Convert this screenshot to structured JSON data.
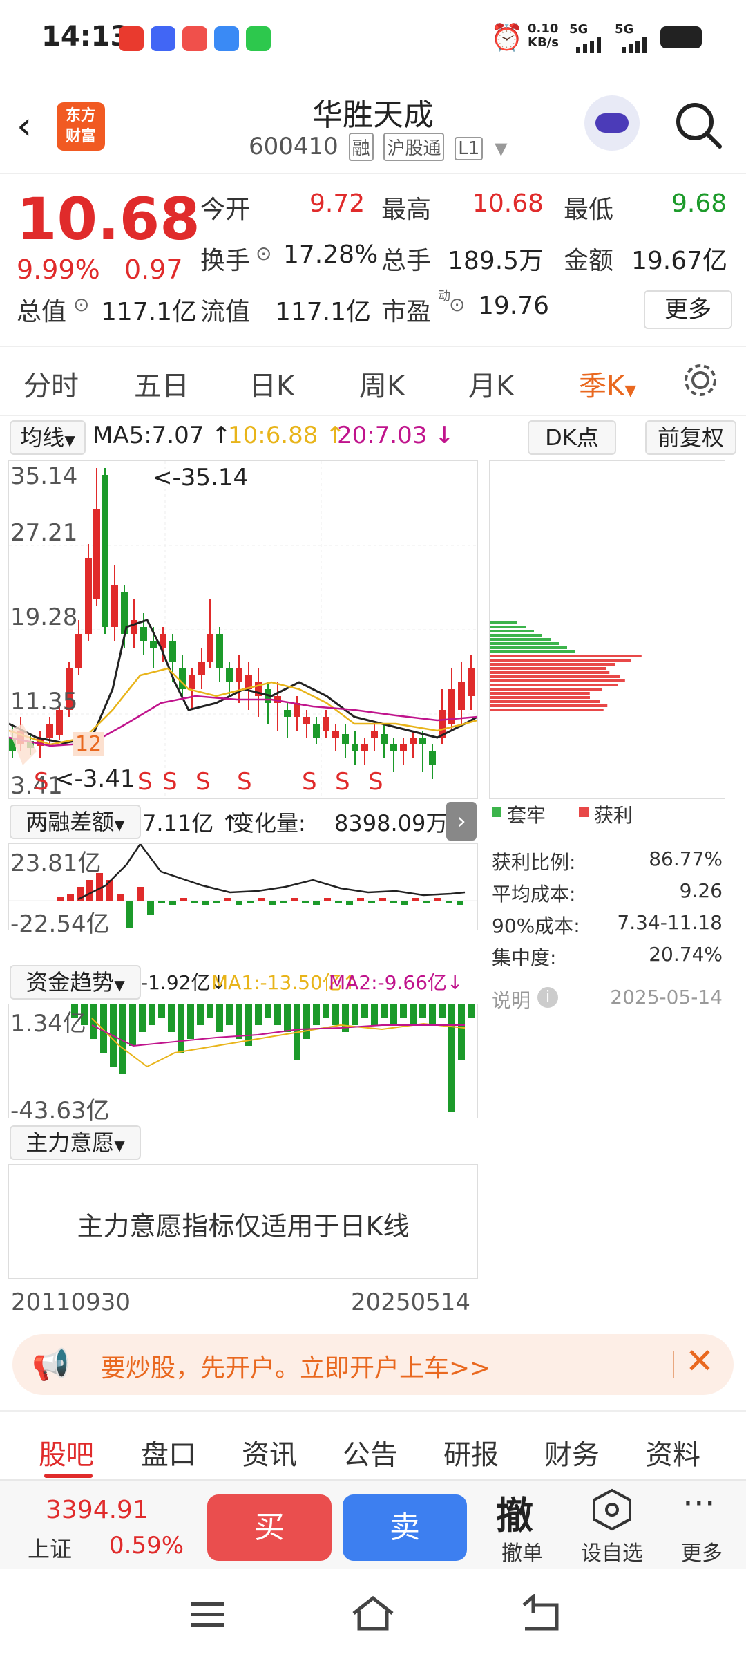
{
  "status": {
    "time": "14:13",
    "net_speed_top": "0.10",
    "net_speed_bottom": "KB/s",
    "sim1": "5G",
    "sim2": "5G"
  },
  "header": {
    "name": "华胜天成",
    "code": "600410",
    "tags": [
      "融",
      "沪股通",
      "L1"
    ],
    "logo_text_1": "东方",
    "logo_text_2": "财富"
  },
  "quote": {
    "price": "10.68",
    "pct": "9.99%",
    "change": "0.97",
    "open_label": "今开",
    "open": "9.72",
    "high_label": "最高",
    "high": "10.68",
    "low_label": "最低",
    "low": "9.68",
    "turnover_label": "换手",
    "turnover": "17.28%",
    "volume_label": "总手",
    "volume": "189.5万",
    "amount_label": "金额",
    "amount": "19.67亿",
    "mktcap_label": "总值",
    "mktcap": "117.1亿",
    "float_label": "流值",
    "float": "117.1亿",
    "pe_label": "市盈",
    "pe_sup": "动",
    "pe": "19.76",
    "more": "更多"
  },
  "ktabs": [
    "分时",
    "五日",
    "日K",
    "周K",
    "月K",
    "季K"
  ],
  "ktabs_active": 5,
  "ma": {
    "selector": "均线",
    "ma5": "MA5:7.07 ↑",
    "ma10": "10:6.88 ↑",
    "ma20": "20:7.03 ↓",
    "dk": "DK点",
    "adjust": "前复权"
  },
  "colors": {
    "up": "#e02b2b",
    "down": "#1c9a2a",
    "ma5": "#222222",
    "ma10": "#e8b41a",
    "ma20": "#c0148c",
    "accent": "#e9681f"
  },
  "main_chart": {
    "y_labels": [
      "35.14",
      "27.21",
      "19.28",
      "11.35",
      "3.41"
    ],
    "high_mark": "<-35.14",
    "low_mark": "<-3.41",
    "sell_marks": [
      "S",
      "S",
      "S",
      "S",
      "S",
      "S",
      "S",
      "S",
      "S",
      "S",
      "S"
    ],
    "buy_mark": "12"
  },
  "margin": {
    "selector": "两融差额",
    "value": "7.11亿 ↑",
    "change_label": "变化量:",
    "change": "8398.09万 ↑",
    "top": "23.81亿",
    "bottom": "-22.54亿"
  },
  "fund": {
    "selector": "资金趋势",
    "value": "-1.92亿↓",
    "ma1": "MA1:-13.50亿↑",
    "ma2": "MA2:-9.66亿↓",
    "top": "1.34亿",
    "bottom": "-43.63亿"
  },
  "intent": {
    "selector": "主力意愿",
    "message": "主力意愿指标仅适用于日K线"
  },
  "dates": {
    "start": "20110930",
    "end": "20250514"
  },
  "chip": {
    "legend_trap": "套牢",
    "legend_profit": "获利",
    "rows": [
      {
        "k": "获利比例:",
        "v": "86.77%"
      },
      {
        "k": "平均成本:",
        "v": "9.26"
      },
      {
        "k": "90%成本:",
        "v": "7.34-11.18"
      },
      {
        "k": "集中度:",
        "v": "20.74%"
      }
    ],
    "note": "说明",
    "date": "2025-05-14"
  },
  "banner": {
    "text": "要炒股，先开户。立即开户上车>>"
  },
  "btabs": [
    "股吧",
    "盘口",
    "资讯",
    "公告",
    "研报",
    "财务",
    "资料"
  ],
  "btabs_active": 0,
  "trade": {
    "index_value": "3394.91",
    "index_name": "上证",
    "index_pct": "0.59%",
    "buy": "买",
    "sell": "卖",
    "cancel_glyph": "撤",
    "cancel": "撤单",
    "watch": "设自选",
    "more": "更多"
  }
}
